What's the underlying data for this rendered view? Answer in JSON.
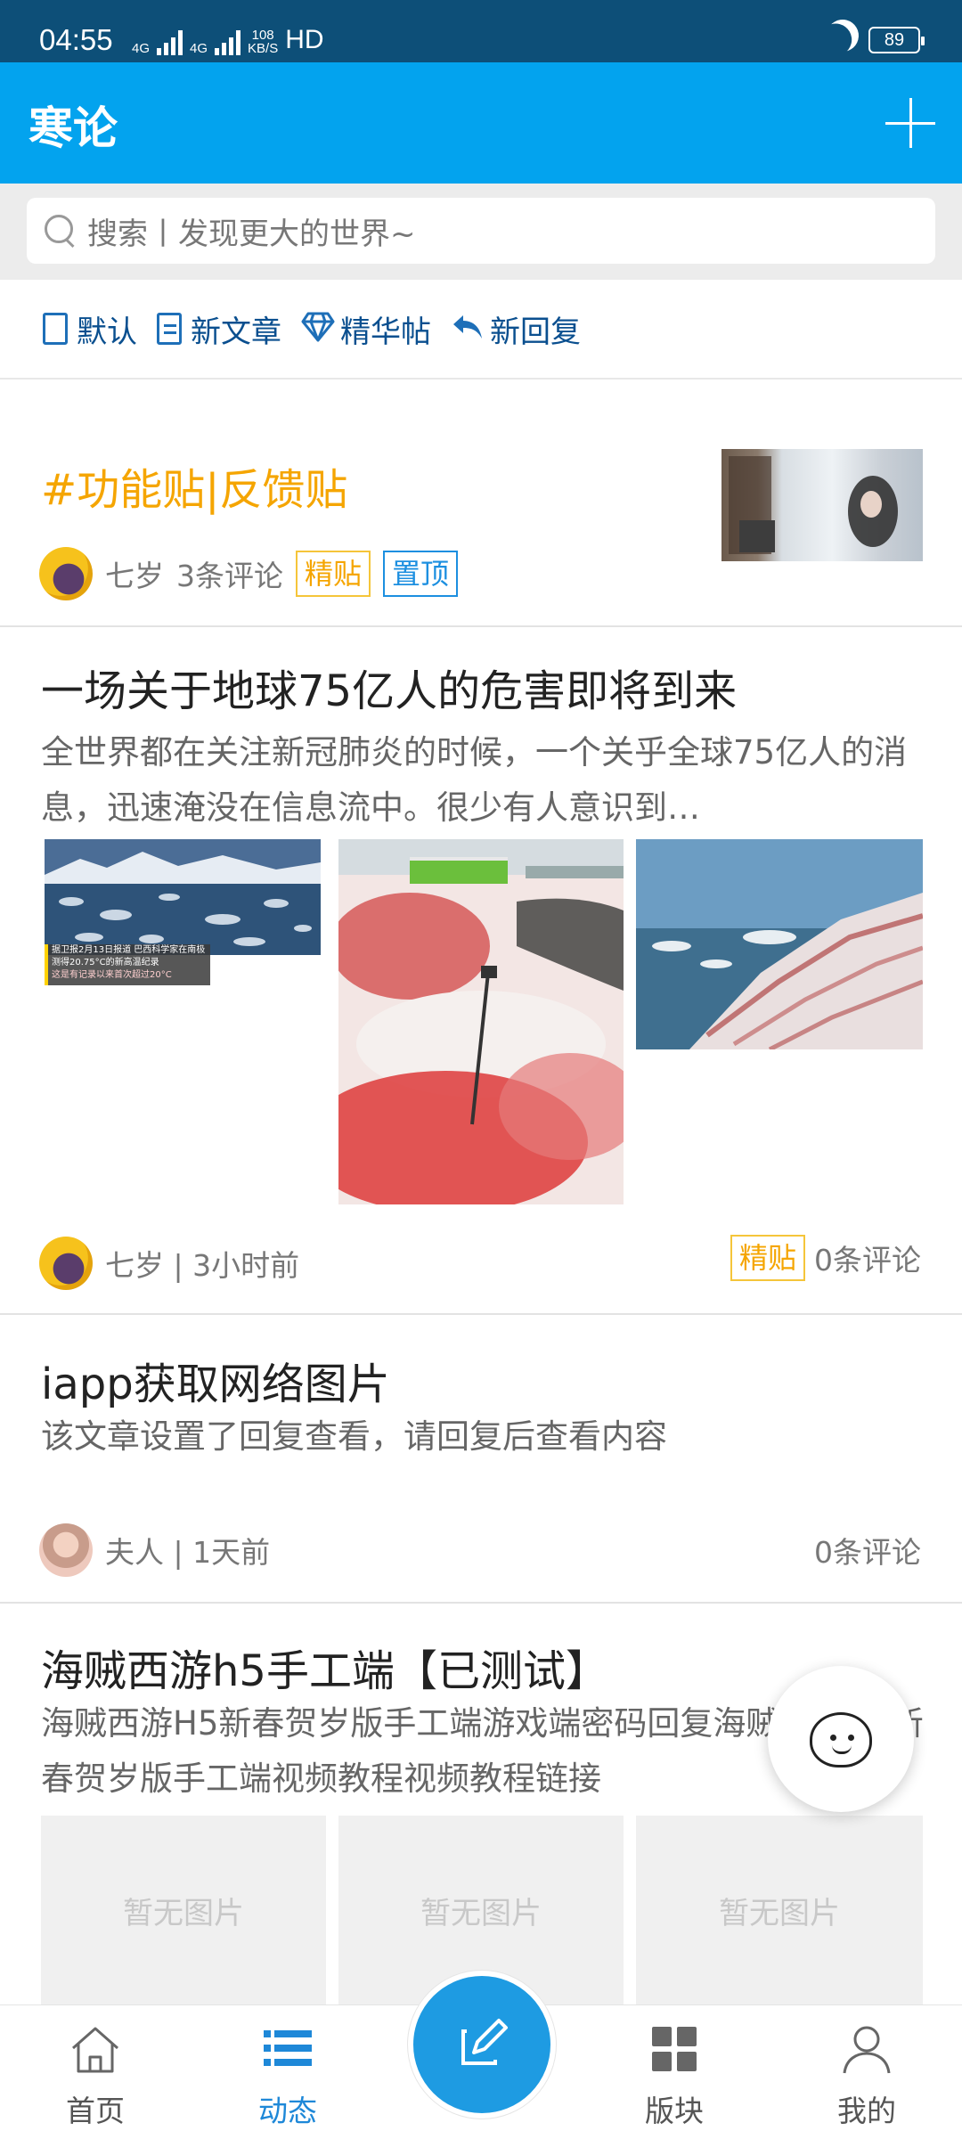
{
  "status_bar": {
    "time": "04:55",
    "net1": "4G",
    "net2": "4G",
    "speed_top": "108",
    "speed_bottom": "KB/S",
    "hd": "HD",
    "battery": "89"
  },
  "header": {
    "title": "寒论"
  },
  "search": {
    "placeholder": "搜索丨发现更大的世界~"
  },
  "filters": [
    {
      "label": "默认",
      "icon": "document-icon"
    },
    {
      "label": "新文章",
      "icon": "new-document-icon"
    },
    {
      "label": "精华帖",
      "icon": "diamond-icon"
    },
    {
      "label": "新回复",
      "icon": "reply-icon"
    }
  ],
  "posts": [
    {
      "title": "#功能贴|反馈贴",
      "author": "七岁",
      "comments": "3条评论",
      "tags": [
        "精贴",
        "置顶"
      ],
      "title_color": "#f5a500"
    },
    {
      "title": "一场关于地球75亿人的危害即将到来",
      "excerpt": "全世界都在关注新冠肺炎的时候，一个关乎全球75亿人的消息，迅速淹没在信息流中。很少有人意识到…",
      "author_time": "七岁 | 3小时前",
      "tag": "精贴",
      "comments": "0条评论",
      "image_caption_lines": [
        "据卫报2月13日报道 巴西科学家在南极",
        "测得20.75°C的新高温纪录",
        "这是有记录以来首次超过20°C"
      ]
    },
    {
      "title": "iapp获取网络图片",
      "excerpt": "该文章设置了回复查看，请回复后查看内容",
      "author_time": "夫人 | 1天前",
      "comments": "0条评论"
    },
    {
      "title": "海贼西游h5手工端【已测试】",
      "excerpt": "海贼西游H5新春贺岁版手工端游戏端密码回复海贼西游H5新春贺岁版手工端视频教程视频教程链接",
      "no_image": "暂无图片"
    }
  ],
  "bottom_nav": [
    {
      "label": "首页",
      "icon": "home-icon",
      "active": false
    },
    {
      "label": "动态",
      "icon": "list-icon",
      "active": true
    },
    {
      "label": "",
      "icon": "compose-icon",
      "active": false
    },
    {
      "label": "版块",
      "icon": "grid-icon",
      "active": false
    },
    {
      "label": "我的",
      "icon": "user-icon",
      "active": false
    }
  ],
  "colors": {
    "primary": "#03a3ee",
    "status_bar": "#0d4f78",
    "gold": "#f5a500",
    "link_blue": "#0a4f8f",
    "active_nav": "#1e88d8"
  }
}
